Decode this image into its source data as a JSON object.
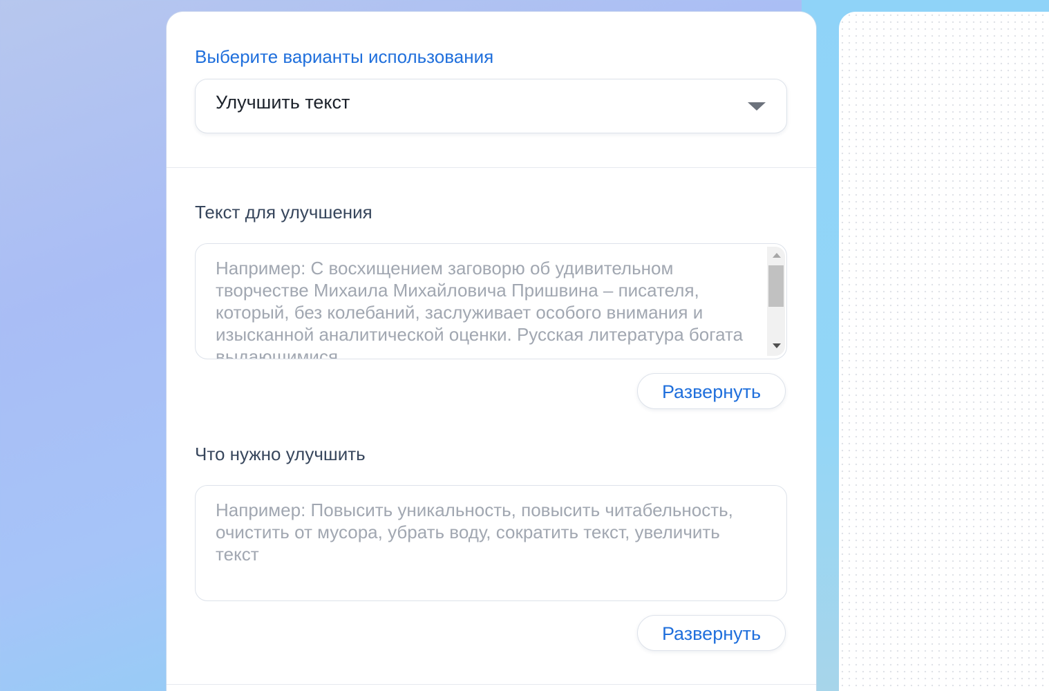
{
  "usecase": {
    "label": "Выберите варианты использования",
    "selected": "Улучшить текст"
  },
  "fields": [
    {
      "label": "Текст для улучшения",
      "placeholder": "Например: С восхищением заговорю об удивительном творчестве Михаила Михайловича Пришвина – писателя, который, без колебаний, заслуживает особого внимания и изысканной аналитической оценки. Русская литература богата выдающимися",
      "expand_label": "Развернуть"
    },
    {
      "label": "Что нужно улучшить",
      "placeholder": "Например: Повысить уникальность, повысить читабельность, очистить от мусора, убрать воду, сократить текст, увеличить текст",
      "expand_label": "Развернуть"
    }
  ],
  "colors": {
    "accent": "#1f6fdc",
    "label": "#37465c",
    "placeholder": "#a1a7b1"
  },
  "icons": {
    "select_arrow": "chevron-down-icon"
  }
}
